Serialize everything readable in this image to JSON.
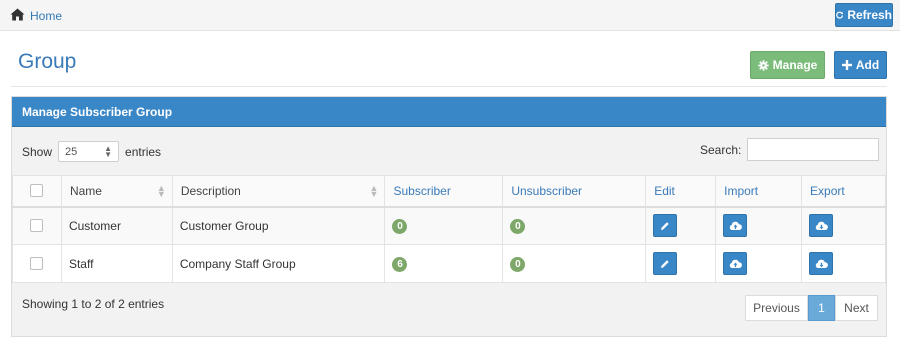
{
  "breadcrumb": {
    "home_label": "Home"
  },
  "toolbar": {
    "refresh_label": "Refresh",
    "manage_label": "Manage",
    "add_label": "Add"
  },
  "page": {
    "title": "Group"
  },
  "panel": {
    "title": "Manage Subscriber Group"
  },
  "length": {
    "show_label": "Show",
    "value": "25",
    "entries_label": "entries"
  },
  "search": {
    "label": "Search:",
    "value": ""
  },
  "table": {
    "headers": [
      "Name",
      "Description",
      "Subscriber",
      "Unsubscriber",
      "Edit",
      "Import",
      "Export"
    ],
    "rows": [
      {
        "name": "Customer",
        "description": "Customer Group",
        "subscriber": "0",
        "unsubscriber": "0"
      },
      {
        "name": "Staff",
        "description": "Company Staff Group",
        "subscriber": "6",
        "unsubscriber": "0"
      }
    ]
  },
  "footer": {
    "info": "Showing 1 to 2 of 2 entries"
  },
  "pagination": {
    "previous": "Previous",
    "current": "1",
    "next": "Next"
  },
  "colors": {
    "primary": "#3a87c8",
    "success": "#7cbc7a",
    "badge": "#7ea76a",
    "title": "#3a7ab8"
  }
}
